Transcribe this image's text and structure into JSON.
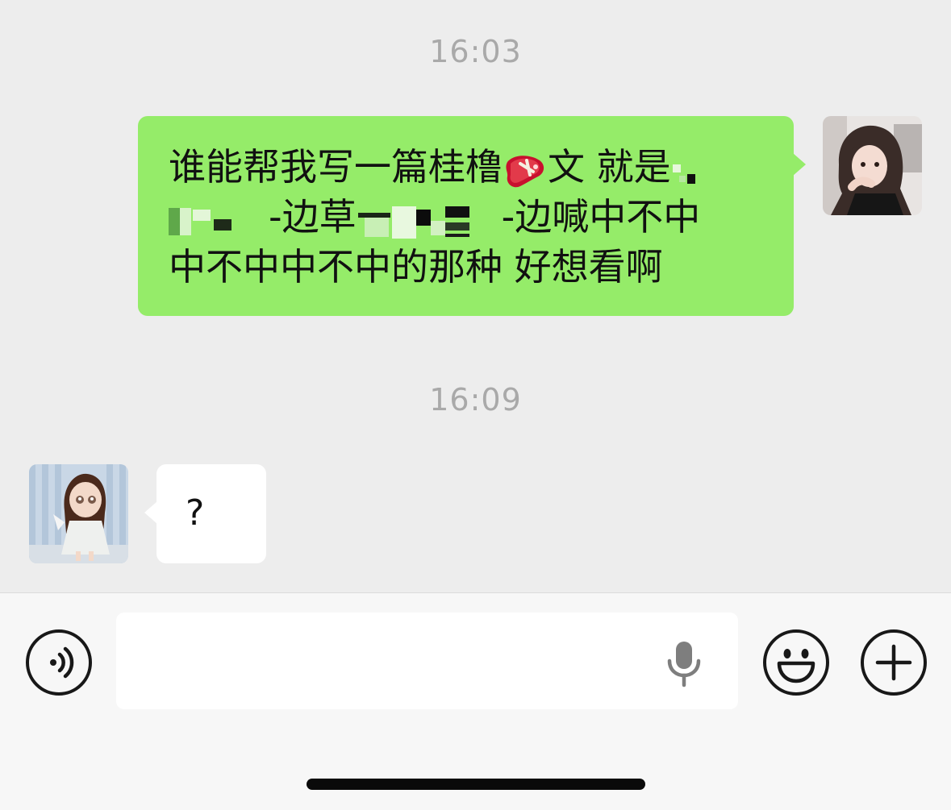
{
  "chat": {
    "messages": [
      {
        "time": "16:03",
        "sender": "me",
        "lines": [
          "谁能帮我写一篇桂橹🥩文 就是",
          "-边草 -边喊中不中",
          "中不中中不中的那种 好想看啊"
        ],
        "line_1_a": "谁能帮我写一篇桂橹",
        "line_1_b": "文 就是",
        "line_2_a": "-边草",
        "line_2_b": "-边喊中不中",
        "line_3": "中不中中不中的那种 好想看啊"
      },
      {
        "time": "16:09",
        "sender": "other",
        "text": "?"
      }
    ]
  },
  "input": {
    "value": "",
    "placeholder": ""
  },
  "icons": {
    "voice_toggle": "voice-wave-icon",
    "microphone": "microphone-icon",
    "emoji": "smiley-face-icon",
    "more": "plus-circle-icon"
  },
  "colors": {
    "background": "#ededed",
    "my_bubble": "#95ec69",
    "their_bubble": "#ffffff",
    "timestamp": "#a9a9a9",
    "toolbar": "#f7f7f7"
  }
}
